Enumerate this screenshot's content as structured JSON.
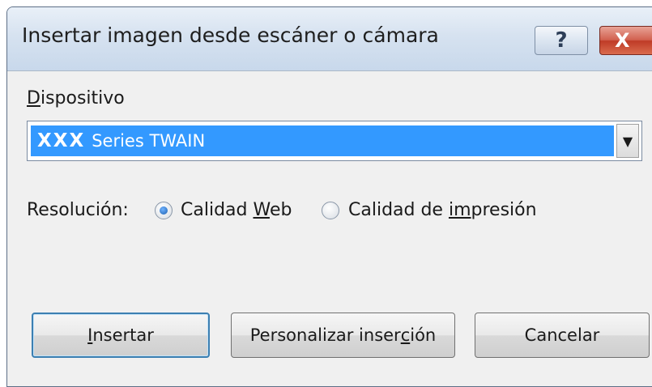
{
  "dialog": {
    "title": "Insertar imagen desde escáner o cámara",
    "help_glyph": "?",
    "close_glyph": "X"
  },
  "device": {
    "label_initial": "D",
    "label_rest": "ispositivo",
    "selected_prefix": "XXX",
    "selected_name": "Series TWAIN",
    "dropdown_glyph": "▼"
  },
  "resolution": {
    "label": "Resolución:",
    "options": [
      {
        "label_before": "Calidad ",
        "label_underlined": "W",
        "label_after": "eb",
        "checked": true
      },
      {
        "label_before": "Calidad de ",
        "label_underlined": "im",
        "label_after": "presión",
        "checked": false
      }
    ]
  },
  "buttons": {
    "insert": {
      "underlined": "I",
      "rest": "nsertar"
    },
    "custom": {
      "before": "Personalizar inser",
      "underlined": "c",
      "after": "ión"
    },
    "cancel": "Cancelar"
  }
}
